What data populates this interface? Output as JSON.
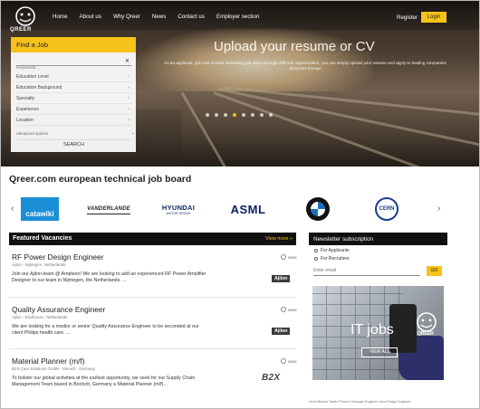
{
  "nav": {
    "logo_text": "QREER",
    "items": [
      "Home",
      "About us",
      "Why Qreer",
      "News",
      "Contact us",
      "Employer section"
    ],
    "register": "Register",
    "login": "Login"
  },
  "hero": {
    "title": "Upload your resume or CV",
    "subtitle": "As an applicant, you can receive interesting job offers through different opportunities, you can simply upload your resume and apply to leading companies all across Europe",
    "slide_count": 8,
    "active_slide": 3
  },
  "find_job": {
    "header": "Find a Job",
    "keywords_placeholder": "Keywords...",
    "filters": [
      "Education Level",
      "Education Background",
      "Specialty",
      "Experience",
      "Location"
    ],
    "advanced": "Advanced options",
    "search": "SEARCH"
  },
  "board": {
    "title": "Qreer.com european technical job board",
    "brands": {
      "catawiki": "catawiki",
      "vanderlande": "VANDERLANDE",
      "hyundai_main": "HYUNDAI",
      "hyundai_sub": "MOTOR GROUP",
      "asml": "ASML",
      "cern": "CERN"
    }
  },
  "vacancies": {
    "header": "Featured Vacancies",
    "view_more": "View more »",
    "save_label": "save",
    "items": [
      {
        "title": "RF Power Design Engineer",
        "location": "Ajilon - Nijmegen, Netherlands",
        "desc": "Join our Ajilon-team @ Ampleon! We are looking to add an experienced RF Power Amplifier Designer to our team in Nijmegen, the Netherlands. ...",
        "company": "Ajilon"
      },
      {
        "title": "Quality Assurance Engineer",
        "location": "Ajilon - Eindhoven, Netherlands",
        "desc": "We are looking for a medior or senior Quality Assurance Engineer to be seconded at our client Philips health care. ...",
        "company": "Ajilon"
      },
      {
        "title": "Material Planner (m/f)",
        "location": "B2X Care Solutions GmbH - Munich , Germany",
        "desc": "To bolster our global activities at the earliest opportunity, we seek for our Supply Chain Management Team based in Bocholt, Germany a Material Planner (m/f)...",
        "company": "B2X"
      }
    ]
  },
  "newsletter": {
    "header": "Newsletter subscription",
    "option_applicants": "For Applicants",
    "option_recruiters": "For Recruiters",
    "email_placeholder": "Enter email",
    "go": "GO"
  },
  "banner": {
    "text": "IT jobs",
    "button": "VIEW ALL",
    "logo_text": "QREER"
  },
  "tags": "Hmm Bedrok Taalen  Product  Manager  Engineer  Java  Design  Engineer",
  "colors": {
    "accent": "#f6c21a",
    "header_bg": "#111111"
  }
}
